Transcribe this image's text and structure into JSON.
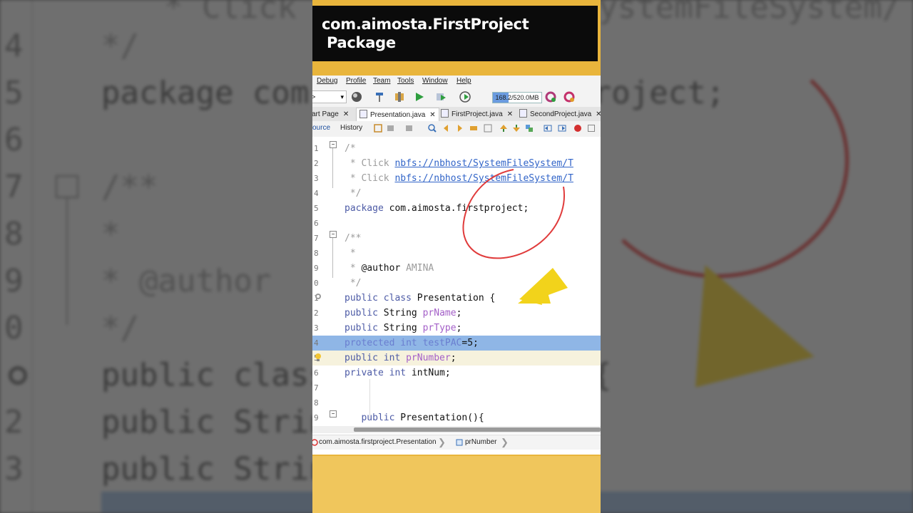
{
  "banner": {
    "line1": "com.aimosta.FirstProject",
    "line2": "Package"
  },
  "menu": [
    "Debug",
    "Profile",
    "Team",
    "Tools",
    "Window",
    "Help"
  ],
  "toolbar": {
    "combo_value": ">",
    "memory": "168.2/520.0MB",
    "memory_used_fraction": 0.32
  },
  "tabs": [
    {
      "label": "art Page"
    },
    {
      "label": "Presentation.java"
    },
    {
      "label": "FirstProject.java"
    },
    {
      "label": "SecondProject.java"
    }
  ],
  "editor_toolbar": {
    "source": "ource",
    "history": "History"
  },
  "code": [
    {
      "n": "1",
      "parts": [
        [
          "cm",
          "/*"
        ]
      ]
    },
    {
      "n": "2",
      "parts": [
        [
          "cm",
          " * Click "
        ],
        [
          "lk",
          "nbfs://nbhost/SystemFileSystem/T"
        ]
      ]
    },
    {
      "n": "3",
      "parts": [
        [
          "cm",
          " * Click "
        ],
        [
          "lk",
          "nbfs://nbhost/SystemFileSystem/T"
        ]
      ]
    },
    {
      "n": "4",
      "parts": [
        [
          "cm",
          " */"
        ]
      ]
    },
    {
      "n": "5",
      "parts": [
        [
          "kw",
          "package "
        ],
        [
          "cl",
          "com.aimosta.firstproject;"
        ]
      ]
    },
    {
      "n": "6",
      "parts": []
    },
    {
      "n": "7",
      "parts": [
        [
          "cm",
          "/**"
        ]
      ]
    },
    {
      "n": "8",
      "parts": [
        [
          "cm",
          " *"
        ]
      ]
    },
    {
      "n": "9",
      "parts": [
        [
          "cm",
          " * "
        ],
        [
          "cl",
          "@author "
        ],
        [
          "cm",
          "AMINA"
        ]
      ]
    },
    {
      "n": "0",
      "parts": [
        [
          "cm",
          " */"
        ]
      ]
    },
    {
      "n": "1",
      "parts": [
        [
          "kw",
          "public class "
        ],
        [
          "cl",
          "Presentation {"
        ]
      ]
    },
    {
      "n": "2",
      "parts": [
        [
          "kw",
          "public "
        ],
        [
          "cl",
          "String "
        ],
        [
          "fd",
          "prName"
        ],
        [
          "cl",
          ";"
        ]
      ]
    },
    {
      "n": "3",
      "parts": [
        [
          "kw",
          "public "
        ],
        [
          "cl",
          "String "
        ],
        [
          "fd",
          "prType"
        ],
        [
          "cl",
          ";"
        ]
      ]
    },
    {
      "n": "4",
      "parts": [
        [
          "kw",
          "protected int "
        ],
        [
          "fd",
          "testPAC"
        ],
        [
          "cl",
          "=5;"
        ]
      ]
    },
    {
      "n": "5",
      "parts": [
        [
          "kw",
          "public int "
        ],
        [
          "fd",
          "prNumber"
        ],
        [
          "cl",
          ";"
        ]
      ]
    },
    {
      "n": "6",
      "parts": [
        [
          "kw",
          "private int "
        ],
        [
          "cl",
          "intNum;"
        ]
      ]
    },
    {
      "n": "7",
      "parts": []
    },
    {
      "n": "8",
      "parts": []
    },
    {
      "n": "9",
      "parts": [
        [
          "cl",
          "   "
        ],
        [
          "kw",
          "public "
        ],
        [
          "cl",
          "Presentation(){"
        ]
      ]
    }
  ],
  "breadcrumb": {
    "class_path": "com.aimosta.firstproject.Presentation",
    "member": "prNumber"
  },
  "background": {
    "numbers": [
      "4",
      "5",
      "6",
      "7",
      "8",
      "9",
      "0",
      "",
      "2",
      "3"
    ],
    "code": [
      "   */",
      "package com.aimosta.firstproject;",
      "",
      "/**",
      "  *",
      "  * @author",
      "  */",
      "public class Presentation {",
      "public String",
      "public String"
    ],
    "top_fragment": "* Click nbfs://nbhost/SystemFileSystem/"
  },
  "colors": {
    "accent_yellow": "#f2d31b",
    "circle_red": "#e03b3b",
    "selection": "#8fb6e6"
  }
}
